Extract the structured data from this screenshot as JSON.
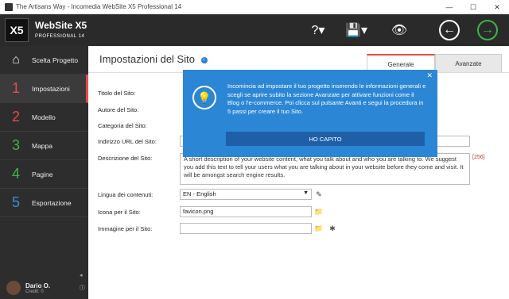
{
  "window": {
    "title": "The Artisans Way - Incomedia WebSite X5 Professional 14"
  },
  "brand": {
    "name": "WebSite X5",
    "edition": "PROFESSIONAL 14"
  },
  "header_icons": [
    "help-icon",
    "save-icon",
    "preview-icon",
    "back-icon",
    "forward-icon"
  ],
  "sidebar": {
    "items": [
      {
        "num": "",
        "label": "Scelta Progetto",
        "icon": "home-icon"
      },
      {
        "num": "1",
        "label": "Impostazioni",
        "color": "#e84a4a"
      },
      {
        "num": "2",
        "label": "Modello",
        "color": "#e84a4a"
      },
      {
        "num": "3",
        "label": "Mappa",
        "color": "#3fb24a"
      },
      {
        "num": "4",
        "label": "Pagine",
        "color": "#3fb24a"
      },
      {
        "num": "5",
        "label": "Esportazione",
        "color": "#3b8bd8"
      }
    ],
    "user": {
      "name": "Dario O.",
      "credit": "Credit: 0"
    }
  },
  "main": {
    "title": "Impostazioni del Sito",
    "tabs": [
      {
        "label": "Generale"
      },
      {
        "label": "Avanzate"
      }
    ],
    "fields": {
      "titolo": {
        "label": "Titolo del Sito:"
      },
      "autore": {
        "label": "Autore del Sito:"
      },
      "categoria": {
        "label": "Categoria del Sito:"
      },
      "url": {
        "label": "Indirizzo URL del Sito:"
      },
      "descrizione": {
        "label": "Descrizione del Sito:",
        "value": "A short description of your website content, what you talk about and who you are talking to. We suggest you add this text to tell your users what you are talking about in your website before they come and visit. It will be amongst search engine results.",
        "counter": "[256]"
      },
      "lingua": {
        "label": "Lingua dei contenuti:",
        "value": "EN - English"
      },
      "icona": {
        "label": "Icona per il Sito:",
        "value": "favicon.png"
      },
      "immagine": {
        "label": "Immagine per il Sito:",
        "value": ""
      }
    },
    "popup": {
      "text": "Incomincia ad impostare il tuo progetto inserendo le informazioni generali e scegli se aprire subito la sezione Avanzate per attivare funzioni come il Blog o l'e-commerce. Poi clicca sul pulsante Avanti e segui la procedura in 5 passi per creare il tuo Sito.",
      "button": "HO CAPITO"
    }
  }
}
